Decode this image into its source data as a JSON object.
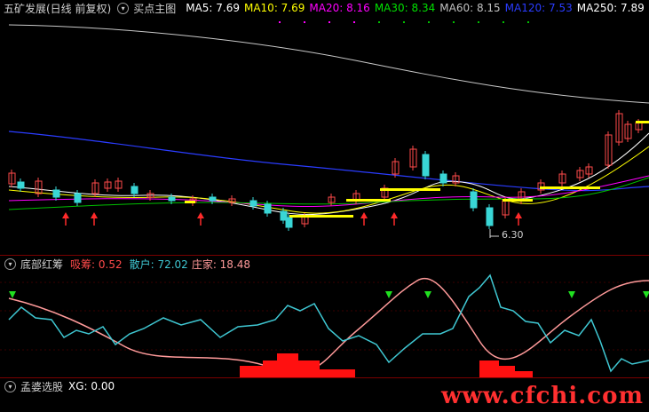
{
  "main": {
    "title": "五矿发展(日线 前复权)",
    "indicator": "买点主图",
    "ma": [
      {
        "label": "MA5: 7.69",
        "color": "#ffffff"
      },
      {
        "label": "MA10: 7.69",
        "color": "#ffff00"
      },
      {
        "label": "MA20: 8.16",
        "color": "#ff00ff"
      },
      {
        "label": "MA30: 8.34",
        "color": "#00e000"
      },
      {
        "label": "MA60: 8.15",
        "color": "#c0c0c0"
      },
      {
        "label": "MA120: 7.53",
        "color": "#2a3cff"
      },
      {
        "label": "MA250: 7.89",
        "color": "#ffffff"
      }
    ],
    "low_label": "6.30"
  },
  "sub1": {
    "title": "底部红筹",
    "items": [
      {
        "label": "吸筹: 0.52",
        "color": "#ff4a4a"
      },
      {
        "label": "散户: 72.02",
        "color": "#3fc7d2"
      },
      {
        "label": "庄家: 18.48",
        "color": "#ff9a9a"
      }
    ]
  },
  "sub2": {
    "title": "孟婆选股",
    "items": [
      {
        "label": "XG: 0.00",
        "color": "#ffffff"
      }
    ]
  },
  "watermark": "www.cfchi.com",
  "colors": {
    "up": "#ff4a4a",
    "down": "#39d6d6",
    "ma120": "#2a3cff",
    "ma250": "#c8c8c8",
    "signal_bar": "#ffff00",
    "retail": "#3fc7d2",
    "dealer": "#ff9a9a",
    "watermark": "#ff3030"
  }
}
